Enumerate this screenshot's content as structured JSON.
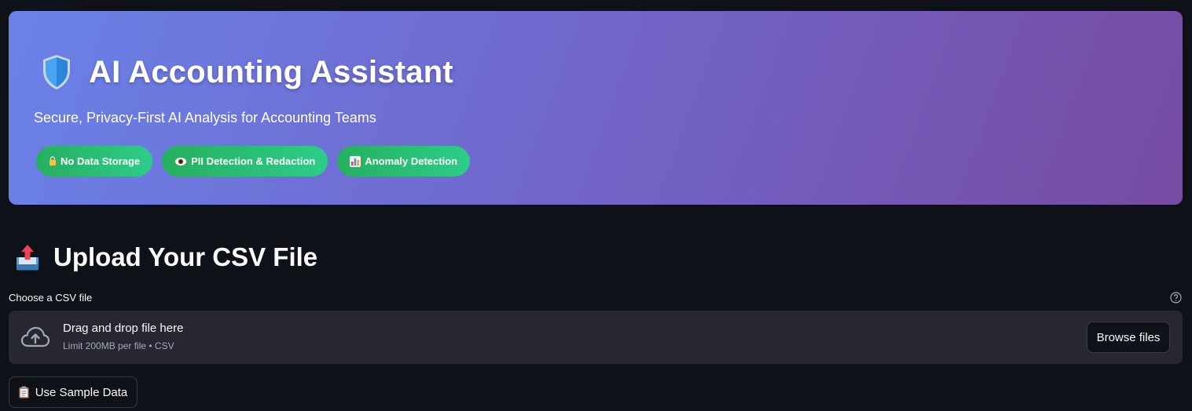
{
  "hero": {
    "title": "AI Accounting Assistant",
    "subtitle": "Secure, Privacy-First AI Analysis for Accounting Teams",
    "icon": "shield-icon",
    "gradient": [
      "#667eea",
      "#764ba2"
    ],
    "badges": [
      {
        "icon": "lock-icon",
        "label": "No Data Storage"
      },
      {
        "icon": "eye-icon",
        "label": "PII Detection & Redaction"
      },
      {
        "icon": "bar-chart-icon",
        "label": "Anomaly Detection"
      }
    ],
    "badge_color": "#27ae60"
  },
  "upload": {
    "icon": "inbox-tray-icon",
    "title": "Upload Your CSV File",
    "field_label": "Choose a CSV file",
    "help_icon": "help-circle-icon",
    "dropzone": {
      "icon": "cloud-upload-icon",
      "main_text": "Drag and drop file here",
      "sub_text": "Limit 200MB per file • CSV",
      "browse_label": "Browse files"
    },
    "sample_button": {
      "icon": "clipboard-icon",
      "label": "Use Sample Data"
    }
  }
}
